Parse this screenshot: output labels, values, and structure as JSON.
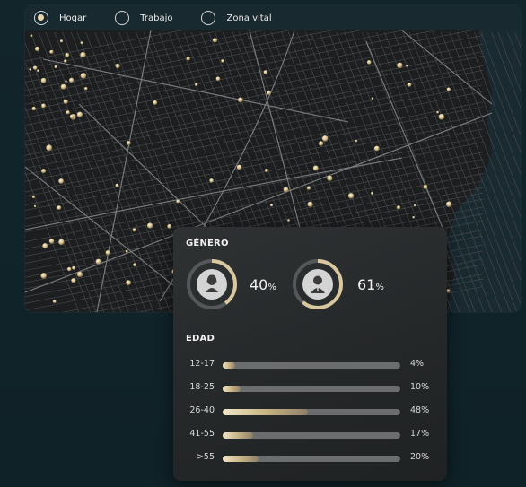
{
  "filters": {
    "options": [
      {
        "label": "Hogar",
        "checked": true
      },
      {
        "label": "Trabajo",
        "checked": false
      },
      {
        "label": "Zona vital",
        "checked": false
      }
    ]
  },
  "gender": {
    "title": "GÉNERO",
    "items": [
      {
        "icon": "female-user-icon",
        "value": "40",
        "unit": "%",
        "fraction": 0.4
      },
      {
        "icon": "male-user-icon",
        "value": "61",
        "unit": "%",
        "fraction": 0.61
      }
    ]
  },
  "age": {
    "title": "EDAD",
    "rows": [
      {
        "label": "12-17",
        "value": "4%",
        "fraction": 0.04
      },
      {
        "label": "18-25",
        "value": "10%",
        "fraction": 0.1
      },
      {
        "label": "26-40",
        "value": "48%",
        "fraction": 0.48
      },
      {
        "label": "41-55",
        "value": "17%",
        "fraction": 0.17
      },
      {
        "label": ">55",
        "value": "20%",
        "fraction": 0.2
      }
    ]
  },
  "colors": {
    "accent_gold": "#e6d6ae",
    "background": "#12252b",
    "map_land": "#1c1e1f",
    "map_sea": "#192a31",
    "panel": "#2a2d2e"
  }
}
